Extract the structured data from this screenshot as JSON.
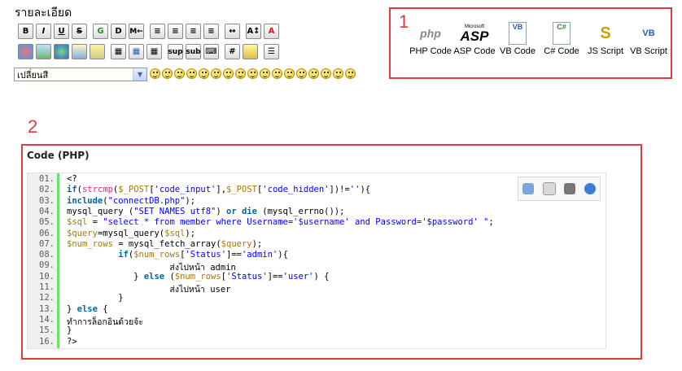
{
  "editor": {
    "title": "รายละเอียด",
    "toolbar_row1": [
      "B",
      "I",
      "U",
      "S",
      "G",
      "D",
      "M",
      "≡L",
      "≡C",
      "≡J",
      "≡R",
      "↔",
      "A↕",
      "A"
    ],
    "toolbar_row2": [
      "sup",
      "sub",
      "#"
    ],
    "color_select": "เปลี่ยนสี",
    "smiley_count": 17
  },
  "annotations": {
    "one": "1",
    "two": "2"
  },
  "code_buttons": [
    {
      "label": "PHP Code",
      "icon": "php-logo-icon",
      "logo": "php"
    },
    {
      "label": "ASP Code",
      "icon": "asp-logo-icon",
      "logo": "ASP",
      "sub": "Microsoft"
    },
    {
      "label": "VB Code",
      "icon": "vb-file-icon",
      "logo": "VB"
    },
    {
      "label": "C# Code",
      "icon": "csharp-file-icon",
      "logo": "C#"
    },
    {
      "label": "JS Script",
      "icon": "js-script-icon",
      "logo": "S"
    },
    {
      "label": "VB Script",
      "icon": "vb-script-icon",
      "logo": "VB"
    }
  ],
  "code_block": {
    "title": "Code (PHP)",
    "lines": [
      {
        "n": "01.",
        "html": "&lt;?"
      },
      {
        "n": "02.",
        "html": "<span class='k'>if</span>(<span class='f'>strcmp</span>(<span class='v'>$_POST</span>[<span class='s'>'code_input'</span>],<span class='v'>$_POST</span>[<span class='s'>'code_hidden'</span>])!=<span class='s'>''</span>){"
      },
      {
        "n": "03.",
        "html": "<span class='k'>include</span>(<span class='s'>\"connectDB.php\"</span>);"
      },
      {
        "n": "04.",
        "html": "mysql_query (<span class='s'>\"SET NAMES utf8\"</span>) <span class='k'>or die</span> (mysql_errno());"
      },
      {
        "n": "05.",
        "html": "<span class='v'>$sql</span> = <span class='s'>\"select * from member where Username='$username' and Password='$password' \"</span>;"
      },
      {
        "n": "06.",
        "html": "<span class='v'>$query</span>=mysql_query(<span class='v'>$sql</span>);"
      },
      {
        "n": "07.",
        "html": "<span class='v'>$num_rows</span> = mysql_fetch_array(<span class='v'>$query</span>);"
      },
      {
        "n": "08.",
        "html": "          <span class='k'>if</span>(<span class='v'>$num_rows</span>[<span class='s'>'Status'</span>]==<span class='s'>'admin'</span>){"
      },
      {
        "n": "09.",
        "html": "                    ส่งไปหน้า admin"
      },
      {
        "n": "10.",
        "html": "             } <span class='k'>else</span> (<span class='v'>$num_rows</span>[<span class='s'>'Status'</span>]==<span class='s'>'user'</span>) {"
      },
      {
        "n": "11.",
        "html": "                    ส่งไปหน้า user"
      },
      {
        "n": "12.",
        "html": "          }"
      },
      {
        "n": "13.",
        "html": "} <span class='k'>else</span> {"
      },
      {
        "n": "14.",
        "html": "ทำการล็อกอินด้วยจ้ะ"
      },
      {
        "n": "15.",
        "html": "}"
      },
      {
        "n": "16.",
        "html": "?&gt;"
      }
    ],
    "tool_icons": [
      "view-source-icon",
      "copy-icon",
      "print-icon",
      "help-icon"
    ]
  },
  "colors": {
    "annotation_red": "#e03c3c",
    "gutter_green": "#6ce26c"
  }
}
